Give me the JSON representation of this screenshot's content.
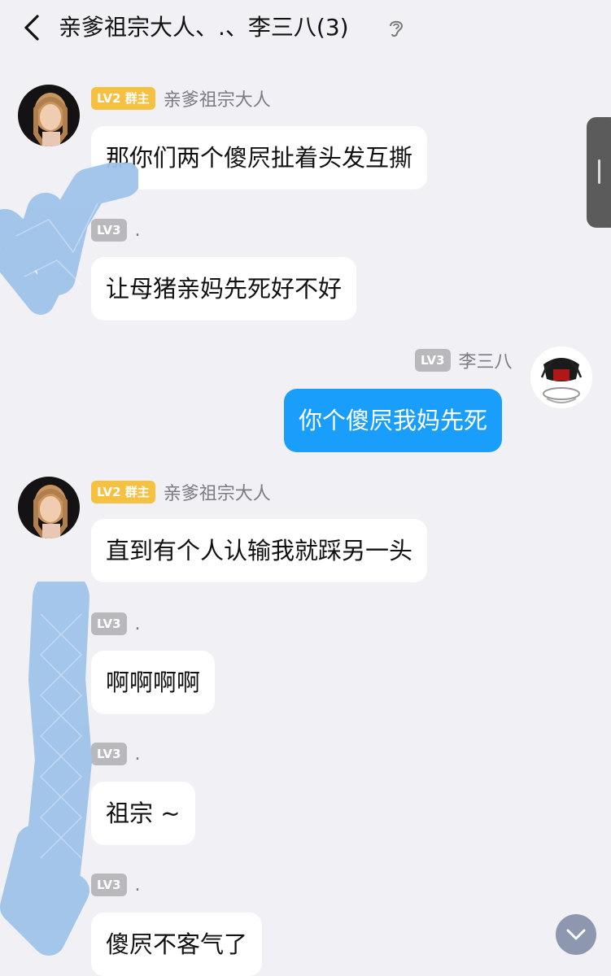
{
  "header": {
    "title": "亲爹祖宗大人、.、李三八(3)",
    "back_icon": "chevron-left-icon",
    "ear_icon": "ear-icon"
  },
  "messages": [
    {
      "badge": "LV2 群主",
      "sender": "亲爹祖宗大人",
      "text": "那你们两个傻屄扯着头发互撕"
    },
    {
      "badge": "LV3",
      "sender": ".",
      "text": "让母猪亲妈先死好不好"
    },
    {
      "badge": "LV3",
      "sender": "李三八",
      "text": "你个傻屄我妈先死"
    },
    {
      "badge": "LV2 群主",
      "sender": "亲爹祖宗大人",
      "text": "直到有个人认输我就踩另一头"
    },
    {
      "badge": "LV3",
      "sender": ".",
      "text": "啊啊啊啊"
    },
    {
      "badge": "LV3",
      "sender": ".",
      "text": "祖宗 ~"
    },
    {
      "badge": "LV3",
      "sender": ".",
      "text": "傻屄不客气了"
    }
  ],
  "colors": {
    "background": "#f0f0f5",
    "outgoing_bubble": "#1a9efc",
    "incoming_bubble": "#ffffff",
    "owner_badge": "#f6c141",
    "level_badge": "#b8b8bd",
    "redaction": "#9fc3ea"
  },
  "controls": {
    "scroll_down_icon": "chevron-down-icon"
  }
}
